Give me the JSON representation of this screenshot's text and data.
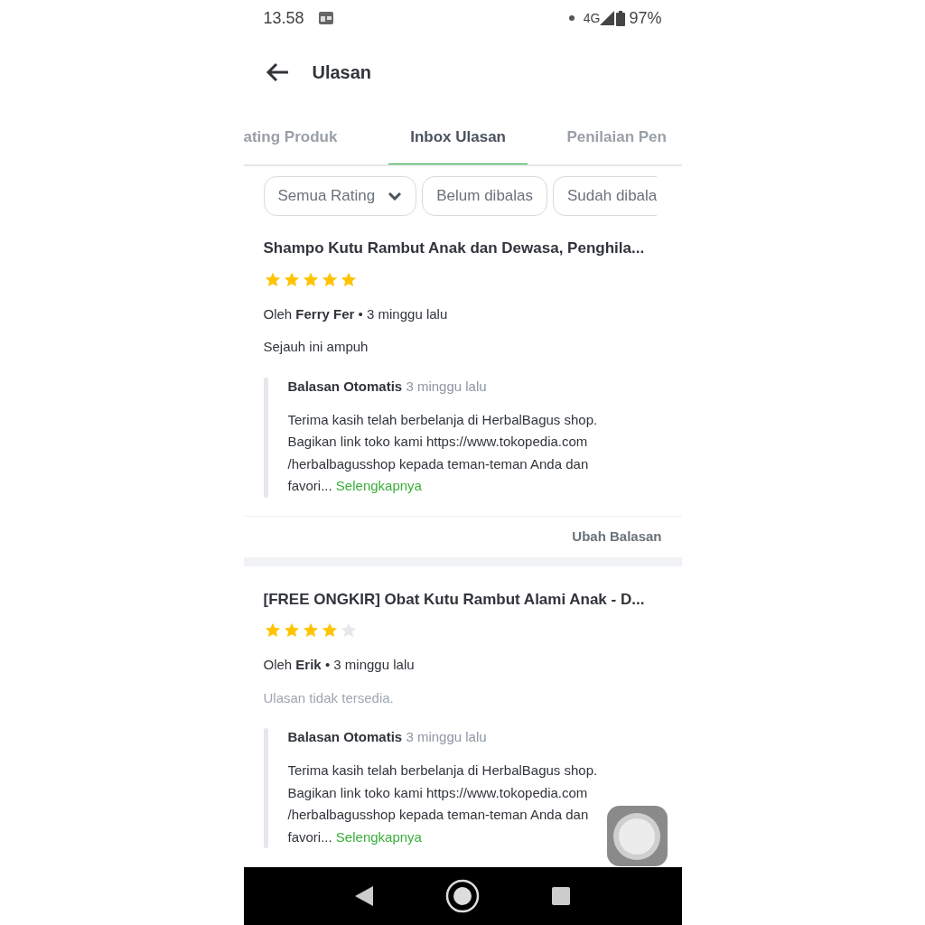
{
  "status_bar": {
    "time": "13.58",
    "network": "4G",
    "battery": "97%"
  },
  "header": {
    "title": "Ulasan"
  },
  "tabs": [
    {
      "label": "ating Produk",
      "selected": false
    },
    {
      "label": "Inbox Ulasan",
      "selected": true
    },
    {
      "label": "Penilaian Pen",
      "selected": false
    }
  ],
  "filters": [
    {
      "label": "Semua Rating",
      "kind": "dropdown"
    },
    {
      "label": "Belum dibalas",
      "kind": "chip"
    },
    {
      "label": "Sudah dibala",
      "kind": "cut"
    }
  ],
  "reviews": [
    {
      "product": "Shampo Kutu Rambut Anak dan Dewasa, Penghila...",
      "stars": 5,
      "by": "Oleh",
      "author": "Ferry Fer",
      "separator": "•",
      "time": "3 minggu lalu",
      "text": "Sejauh ini ampuh",
      "text_available": true,
      "reply": {
        "title": "Balasan Otomatis",
        "time": "3 minggu lalu",
        "lines": [
          "Terima kasih telah berbelanja di HerbalBagus shop.",
          "Bagikan link toko kami https://www.tokopedia.com",
          "/herbalbagusshop kepada teman-teman Anda dan",
          "favori..."
        ],
        "more": "Selengkapnya"
      },
      "action": "Ubah Balasan"
    },
    {
      "product": "[FREE ONGKIR] Obat Kutu Rambut Alami Anak - D...",
      "stars": 4,
      "by": "Oleh",
      "author": "Erik",
      "separator": "•",
      "time": "3 minggu lalu",
      "text": "Ulasan tidak tersedia.",
      "text_available": false,
      "reply": {
        "title": "Balasan Otomatis",
        "time": "3 minggu lalu",
        "lines": [
          "Terima kasih telah berbelanja di HerbalBagus shop.",
          "Bagikan link toko kami https://www.tokopedia.com",
          "/herbalbagusshop kepada teman-teman Anda dan",
          "favori..."
        ],
        "more": "Selengkapnya"
      }
    }
  ]
}
